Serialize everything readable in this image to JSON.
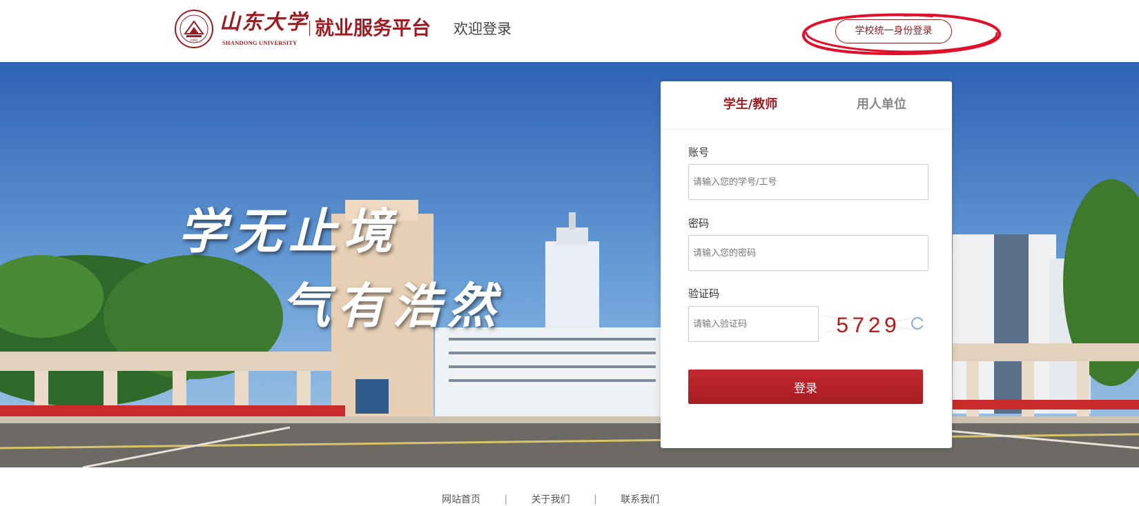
{
  "header": {
    "logo_text_cn": "山东大学",
    "logo_text_en": "SHANDONG UNIVERSITY",
    "platform_title": "就业服务平台",
    "welcome_text": "欢迎登录",
    "sso_login_label": "学校统一身份登录"
  },
  "banner": {
    "slogan_line1": "学无止境",
    "slogan_line2": "气有浩然"
  },
  "login": {
    "tabs": [
      {
        "label": "学生/教师",
        "active": true
      },
      {
        "label": "用人单位",
        "active": false
      }
    ],
    "account_label": "账号",
    "account_placeholder": "请输入您的学号/工号",
    "password_label": "密码",
    "password_placeholder": "请输入您的密码",
    "captcha_label": "验证码",
    "captcha_placeholder": "请输入验证码",
    "captcha_text": "5729",
    "submit_label": "登录"
  },
  "footer": {
    "links": [
      "网站首页",
      "关于我们",
      "联系我们"
    ],
    "separator": "|"
  },
  "colors": {
    "brand_red": "#9b1c22",
    "button_red": "#b52228",
    "highlight_red": "#e0102a",
    "captcha_color": "#b22020"
  },
  "icons": {
    "emblem": "university-emblem-icon",
    "refresh": "refresh-icon"
  }
}
